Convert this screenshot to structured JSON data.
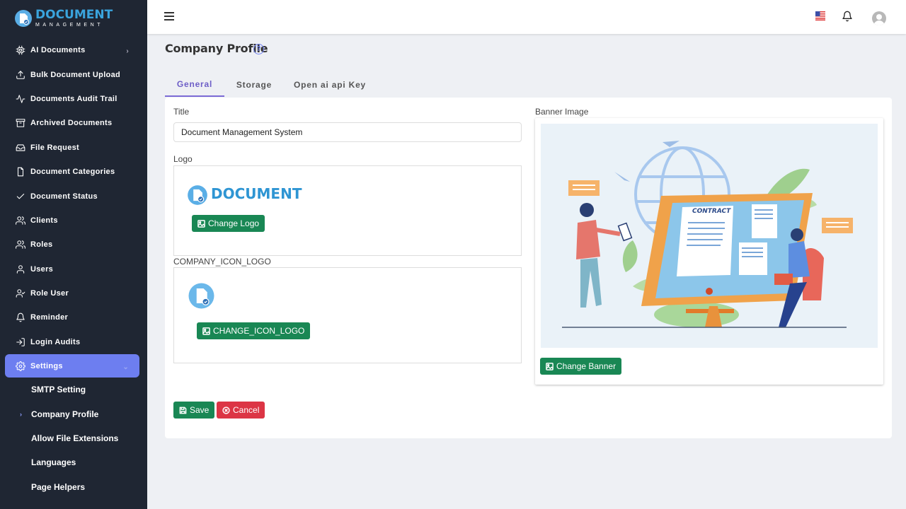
{
  "brand": {
    "title": "DOCUMENT",
    "subtitle": "MANAGEMENT"
  },
  "sidebar": {
    "items": [
      {
        "label": "AI Documents",
        "icon": "chip-icon",
        "chevron": "›"
      },
      {
        "label": "Bulk Document Upload",
        "icon": "upload-icon"
      },
      {
        "label": "Documents Audit Trail",
        "icon": "activity-icon"
      },
      {
        "label": "Archived Documents",
        "icon": "archive-icon"
      },
      {
        "label": "File Request",
        "icon": "inbox-icon"
      },
      {
        "label": "Document Categories",
        "icon": "file-icon"
      },
      {
        "label": "Document Status",
        "icon": "check-icon"
      },
      {
        "label": "Clients",
        "icon": "users-icon"
      },
      {
        "label": "Roles",
        "icon": "users-icon"
      },
      {
        "label": "Users",
        "icon": "user-icon"
      },
      {
        "label": "Role User",
        "icon": "user-check-icon"
      },
      {
        "label": "Reminder",
        "icon": "bell-icon"
      },
      {
        "label": "Login Audits",
        "icon": "login-icon"
      },
      {
        "label": "Settings",
        "icon": "gear-icon",
        "chevron": "⌄"
      }
    ],
    "subitems": [
      {
        "label": "SMTP Setting"
      },
      {
        "label": "Company Profile",
        "marker": "›"
      },
      {
        "label": "Allow File Extensions"
      },
      {
        "label": "Languages"
      },
      {
        "label": "Page Helpers"
      }
    ]
  },
  "page": {
    "title": "Company Profile",
    "help": "?",
    "tabs": [
      "General",
      "Storage",
      "Open ai api Key"
    ]
  },
  "form": {
    "title_label": "Title",
    "title_value": "Document Management System",
    "logo_label": "Logo",
    "logo_text": "DOCUMENT",
    "change_logo": "Change Logo",
    "icon_logo_label": "COMPANY_ICON_LOGO",
    "change_icon_logo": "CHANGE_ICON_LOGO",
    "banner_label": "Banner Image",
    "banner_word": "CONTRACT",
    "change_banner": "Change Banner",
    "save": "Save",
    "cancel": "Cancel"
  },
  "colors": {
    "sidebar": "#1f2633",
    "accent": "#6d7ef0",
    "brand": "#3aa4dd",
    "success": "#198754",
    "danger": "#dc3545"
  }
}
